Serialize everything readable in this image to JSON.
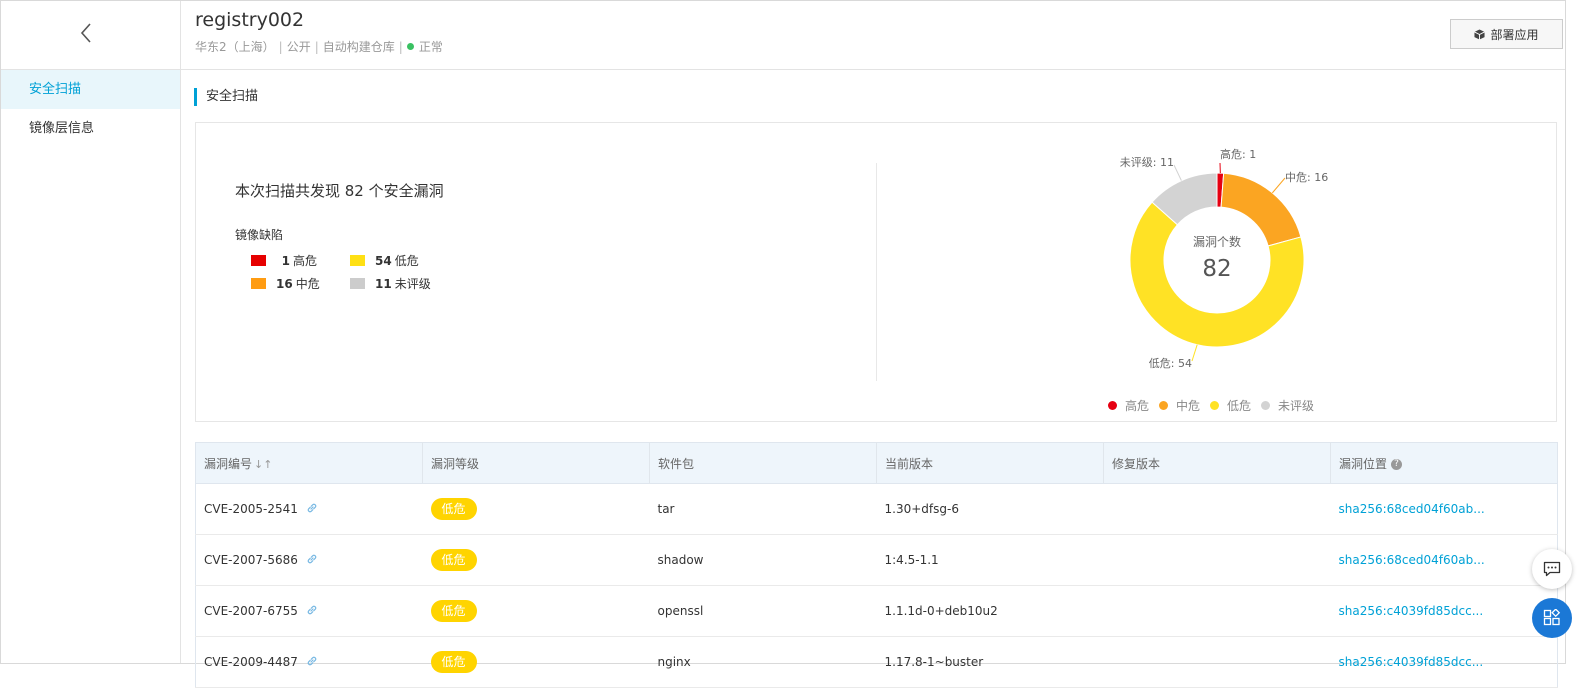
{
  "header": {
    "title": "registry002",
    "region": "华东2（上海）",
    "visibility": "公开",
    "build_type": "自动构建仓库",
    "status": "正常",
    "deploy_label": "部署应用"
  },
  "sidebar": {
    "items": [
      {
        "label": "安全扫描",
        "active": true
      },
      {
        "label": "镜像层信息",
        "active": false
      }
    ]
  },
  "section": {
    "title": "安全扫描"
  },
  "summary": {
    "text": "本次扫描共发现 82 个安全漏洞",
    "defect_label": "镜像缺陷",
    "legend": [
      {
        "count": "1",
        "label": "高危",
        "color": "#e60000"
      },
      {
        "count": "54",
        "label": "低危",
        "color": "#ffe014"
      },
      {
        "count": "16",
        "label": "中危",
        "color": "#ff9c12"
      },
      {
        "count": "11",
        "label": "未评级",
        "color": "#cccccc"
      }
    ]
  },
  "chart_data": {
    "type": "pie",
    "center_label": "漏洞个数",
    "center_value": "82",
    "slices": [
      {
        "label": "高危",
        "value": 1,
        "color": "#e60012",
        "callout": "高危: 1"
      },
      {
        "label": "中危",
        "value": 16,
        "color": "#fba522",
        "callout": "中危: 16"
      },
      {
        "label": "低危",
        "value": 54,
        "color": "#ffe225",
        "callout": "低危: 54"
      },
      {
        "label": "未评级",
        "value": 11,
        "color": "#d3d3d3",
        "callout": "未评级: 11"
      }
    ],
    "legend": [
      "高危",
      "中危",
      "低危",
      "未评级"
    ],
    "legend_colors": [
      "#e60012",
      "#fba522",
      "#ffe225",
      "#d3d3d3"
    ]
  },
  "table": {
    "columns": [
      "漏洞编号",
      "漏洞等级",
      "软件包",
      "当前版本",
      "修复版本",
      "漏洞位置"
    ],
    "sort_icon": "↓↑",
    "rows": [
      {
        "cve": "CVE-2005-2541",
        "level": "低危",
        "package": "tar",
        "version": "1.30+dfsg-6",
        "fix": "",
        "location": "sha256:68ced04f60ab..."
      },
      {
        "cve": "CVE-2007-5686",
        "level": "低危",
        "package": "shadow",
        "version": "1:4.5-1.1",
        "fix": "",
        "location": "sha256:68ced04f60ab..."
      },
      {
        "cve": "CVE-2007-6755",
        "level": "低危",
        "package": "openssl",
        "version": "1.1.1d-0+deb10u2",
        "fix": "",
        "location": "sha256:c4039fd85dcc..."
      },
      {
        "cve": "CVE-2009-4487",
        "level": "低危",
        "package": "nginx",
        "version": "1.17.8-1~buster",
        "fix": "",
        "location": "sha256:c4039fd85dcc..."
      }
    ]
  }
}
